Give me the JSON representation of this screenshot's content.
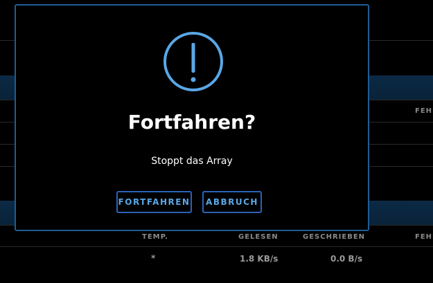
{
  "dialog": {
    "icon": "exclamation-circle-icon",
    "title": "Fortfahren?",
    "message": "Stoppt das Array",
    "confirm_label": "FORTFAHREN",
    "cancel_label": "ABBRUCH",
    "accent_color": "#5aa7e6",
    "border_color": "#1f5c97"
  },
  "background_table": {
    "header_fehler_top": "FEHL",
    "columns": {
      "temp": "TEMP.",
      "read": "GELESEN",
      "written": "GESCHRIEBEN",
      "errors": "FEHL"
    },
    "row": {
      "temp": "*",
      "read": "1.8 KB/s",
      "written": "0.0 B/s"
    }
  }
}
